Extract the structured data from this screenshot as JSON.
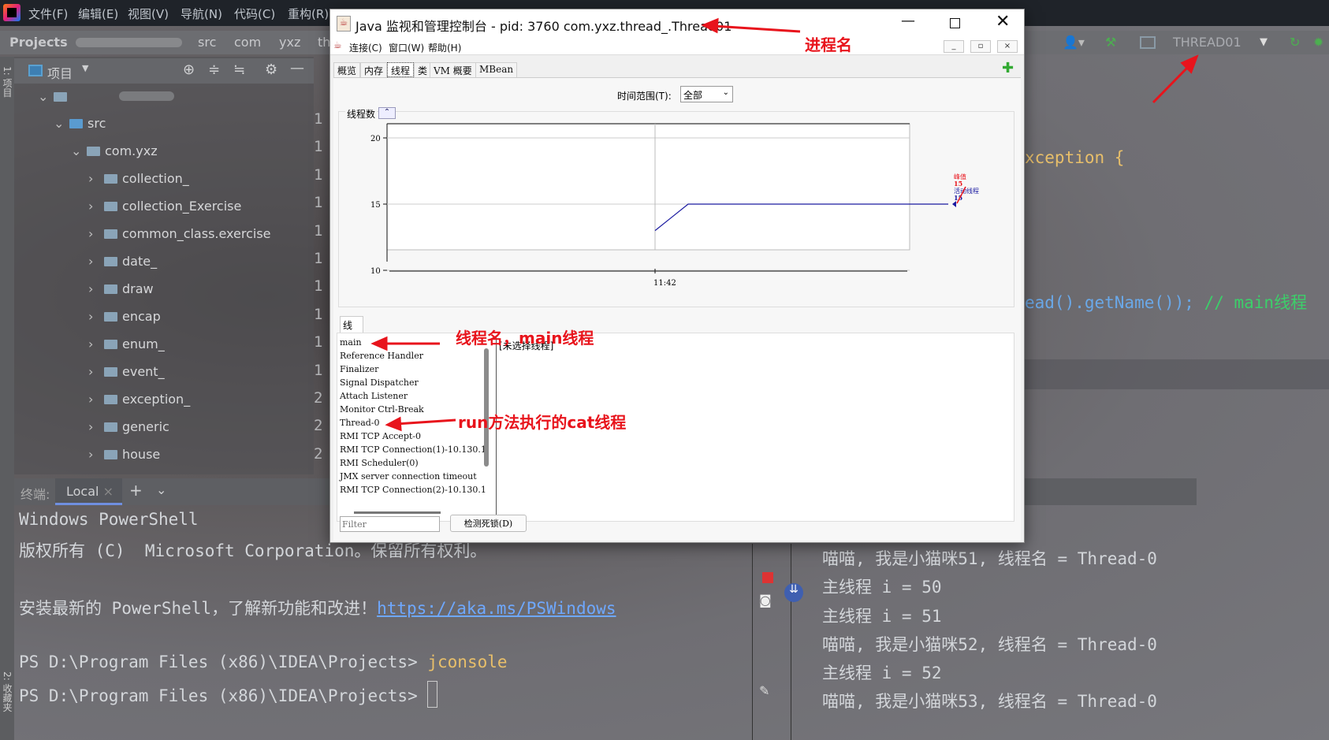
{
  "ide": {
    "menu": [
      "文件(F)",
      "编辑(E)",
      "视图(V)",
      "导航(N)",
      "代码(C)",
      "重构(R)"
    ],
    "breadcrumb": [
      "Projects",
      "src",
      "com",
      "yxz",
      "th"
    ],
    "project_panel": {
      "title": "项目",
      "side_label": "1: 项目",
      "tree": [
        {
          "label": "src",
          "level": 1
        },
        {
          "label": "com.yxz",
          "level": 2
        },
        {
          "label": "collection_",
          "level": 3
        },
        {
          "label": "collection_Exercise",
          "level": 3
        },
        {
          "label": "common_class.exercise",
          "level": 3
        },
        {
          "label": "date_",
          "level": 3
        },
        {
          "label": "draw",
          "level": 3
        },
        {
          "label": "encap",
          "level": 3
        },
        {
          "label": "enum_",
          "level": 3
        },
        {
          "label": "event_",
          "level": 3
        },
        {
          "label": "exception_",
          "level": 3
        },
        {
          "label": "generic",
          "level": 3
        },
        {
          "label": "house",
          "level": 3
        }
      ]
    },
    "run_config": "THREAD01",
    "gutter": [
      "1",
      "1",
      "1",
      "1",
      "1",
      "1",
      "1",
      "1",
      "1",
      "1",
      "2",
      "2",
      "2"
    ],
    "code_lines": [
      {
        "text": "xception {",
        "color": "#e8bf6a"
      },
      {
        "parts": [
          {
            "text": "ead().getName()); ",
            "color": "#6aa8e8"
          },
          {
            "text": "// main线程",
            "color": "#3ccf6a"
          }
        ]
      }
    ],
    "terminal": {
      "label": "终端:",
      "tab": "Local",
      "lines": [
        "Windows PowerShell",
        "版权所有 (C)  Microsoft Corporation。保留所有权利。",
        "",
        "安装最新的 PowerShell，了解新功能和改进！",
        "PS D:\\Program Files (x86)\\IDEA\\Projects> ",
        "PS D:\\Program Files (x86)\\IDEA\\Projects> "
      ],
      "link": "https://aka.ms/PSWindows",
      "command": "jconsole"
    },
    "side_label_bottom": "2: 收藏夹",
    "console_lines": [
      "喵喵, 我是小猫咪51, 线程名 = Thread-0",
      "主线程 i = 50",
      "主线程 i = 51",
      "喵喵, 我是小猫咪52, 线程名 = Thread-0",
      "主线程 i = 52",
      "喵喵, 我是小猫咪53, 线程名 = Thread-0"
    ]
  },
  "jconsole": {
    "title": "Java 监视和管理控制台 - pid: 3760 com.yxz.thread_.Thread01",
    "menu": [
      "连接(C)",
      "窗口(W)",
      "帮助(H)"
    ],
    "tabs": [
      "概览",
      "内存",
      "线程",
      "类",
      "VM 概要",
      "MBean"
    ],
    "active_tab": "线程",
    "time_range_label": "时间范围(T):",
    "time_range_value": "全部",
    "chart_title": "线程数",
    "legend": {
      "peak_label": "峰值",
      "peak_value": "15",
      "live_label": "活动线程",
      "live_value": "15",
      "peak_color": "#e8141c",
      "live_color": "#1a1aa0"
    },
    "threads_title": "线程",
    "threads": [
      "main",
      "Reference Handler",
      "Finalizer",
      "Signal Dispatcher",
      "Attach Listener",
      "Monitor Ctrl-Break",
      "Thread-0",
      "RMI TCP Accept-0",
      "RMI TCP Connection(1)-10.130.1",
      "RMI Scheduler(0)",
      "JMX server connection timeout",
      "RMI TCP Connection(2)-10.130.1"
    ],
    "details_placeholder": "[未选择线程]",
    "filter_placeholder": "Filter",
    "deadlock_button": "检测死锁(D)"
  },
  "annotations": {
    "process_name": "进程名",
    "main_thread": "线程名，main线程",
    "cat_thread": "run方法执行的cat线程"
  },
  "chart_data": {
    "type": "line",
    "title": "线程数",
    "xlabel": "",
    "ylabel": "",
    "ylim": [
      10,
      20
    ],
    "yticks": [
      10,
      15,
      20
    ],
    "xticks": [
      "11:42"
    ],
    "grid": true,
    "series": [
      {
        "name": "活动线程",
        "color": "#1a1aa0",
        "values": [
          13,
          14,
          15,
          15,
          15,
          15,
          15,
          15,
          15,
          15,
          15
        ]
      }
    ]
  }
}
